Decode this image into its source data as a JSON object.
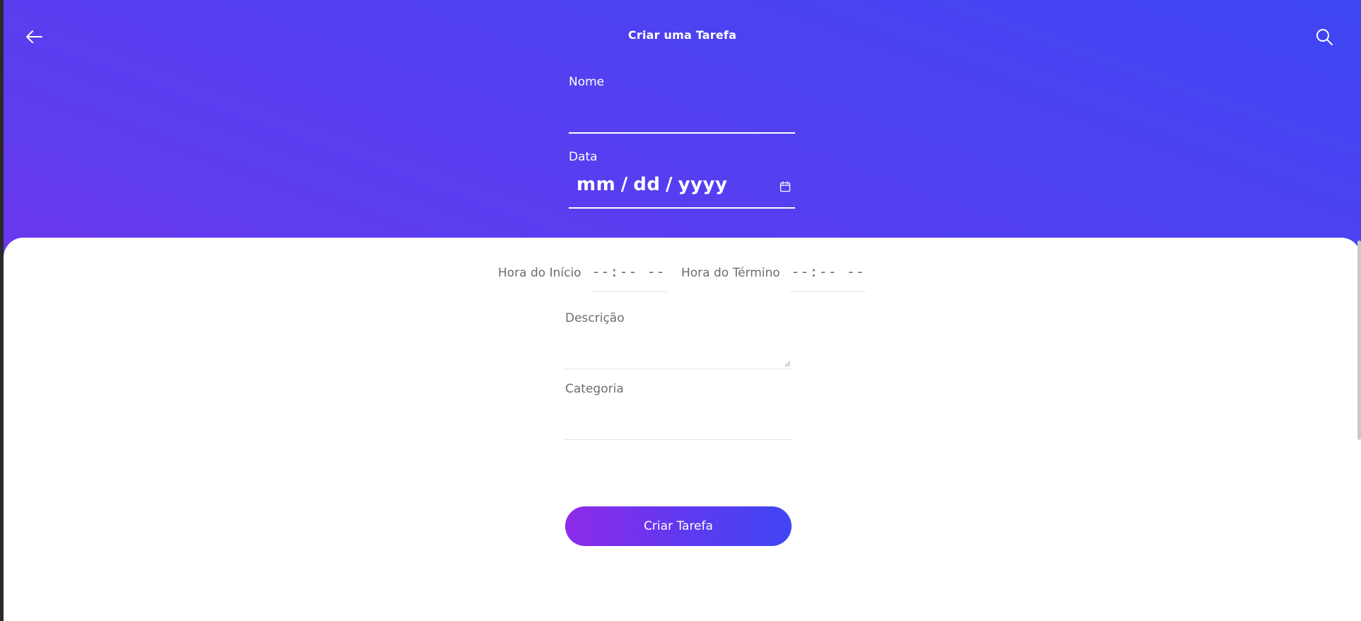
{
  "header": {
    "title": "Criar uma Tarefa",
    "back_icon": "arrow-left-icon",
    "search_icon": "search-icon"
  },
  "form": {
    "nome": {
      "label": "Nome",
      "value": ""
    },
    "data": {
      "label": "Data",
      "placeholder": "mm / dd / yyyy",
      "icon": "calendar-icon"
    },
    "hora_inicio": {
      "label": "Hora do Início",
      "placeholder": "--:-- --"
    },
    "hora_termino": {
      "label": "Hora do Término",
      "placeholder": "--:-- --"
    },
    "descricao": {
      "label": "Descrição",
      "value": ""
    },
    "categoria": {
      "label": "Categoria",
      "value": ""
    },
    "submit_label": "Criar Tarefa"
  },
  "colors": {
    "gradient_start": "#8a2be8",
    "gradient_mid": "#5f3cf0",
    "gradient_end": "#3f46f2",
    "panel_bg": "#ffffff",
    "label_gray": "#6d6d6d"
  }
}
